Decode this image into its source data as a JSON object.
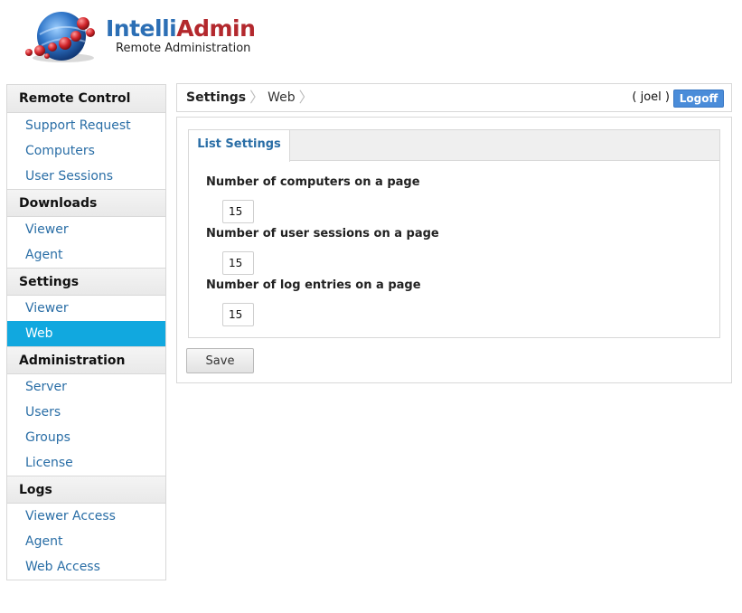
{
  "header": {
    "logo_part1": "Intelli",
    "logo_part2": "Admin",
    "subtitle": "Remote Administration"
  },
  "sidebar": {
    "sections": [
      {
        "title": "Remote Control",
        "items": [
          "Support Request",
          "Computers",
          "User Sessions"
        ]
      },
      {
        "title": "Downloads",
        "items": [
          "Viewer",
          "Agent"
        ]
      },
      {
        "title": "Settings",
        "items": [
          "Viewer",
          "Web"
        ]
      },
      {
        "title": "Administration",
        "items": [
          "Server",
          "Users",
          "Groups",
          "License"
        ]
      },
      {
        "title": "Logs",
        "items": [
          "Viewer Access",
          "Agent",
          "Web Access"
        ]
      }
    ],
    "active": "Settings/Web"
  },
  "topbar": {
    "breadcrumb": [
      "Settings",
      "Web"
    ],
    "user": "( joel )",
    "logoff_label": "Logoff"
  },
  "main": {
    "tab_label": "List Settings",
    "fields": [
      {
        "label": "Number of computers on a page",
        "value": "15"
      },
      {
        "label": "Number of user sessions on a page",
        "value": "15"
      },
      {
        "label": "Number of log entries on a page",
        "value": "15"
      }
    ],
    "save_label": "Save"
  },
  "colors": {
    "accent": "#11a8df",
    "link": "#2a6ea6",
    "logoff": "#4a8cd9",
    "logo_blue": "#2c6fb5",
    "logo_red": "#b3282d"
  }
}
